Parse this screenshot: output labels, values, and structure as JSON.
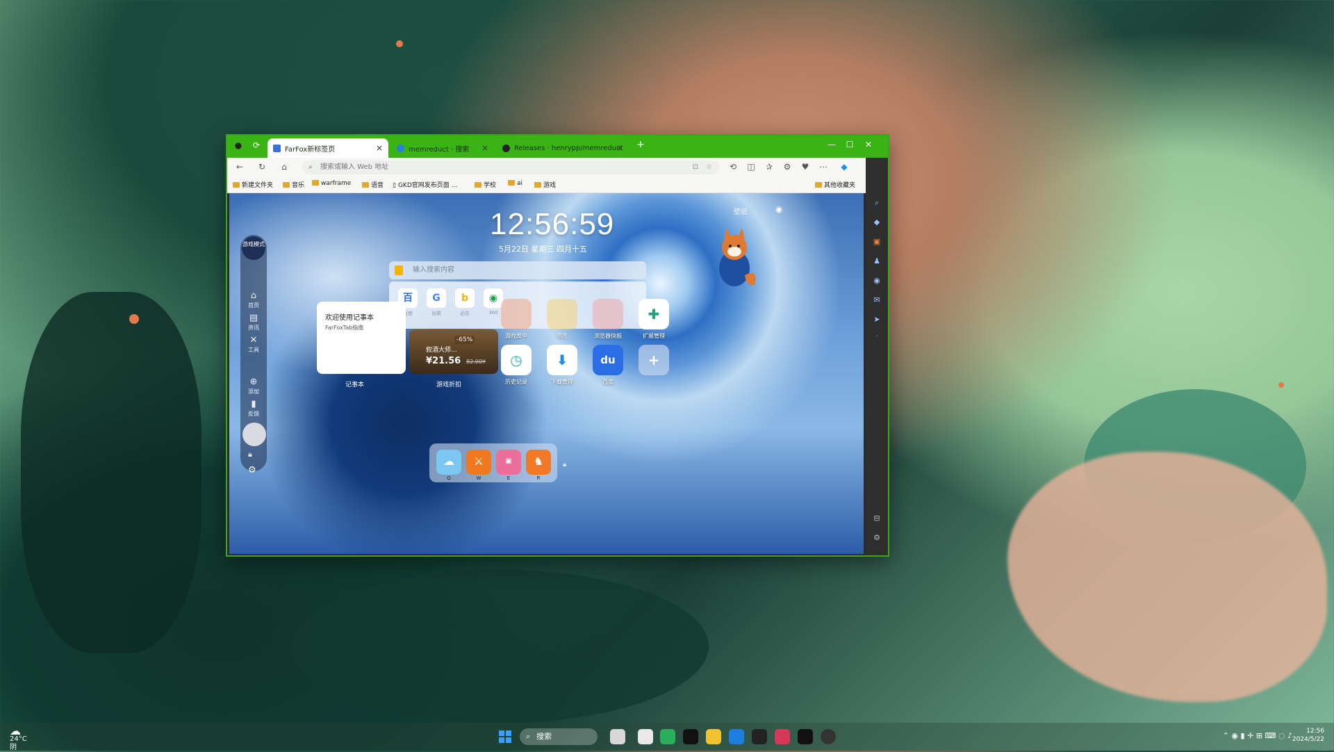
{
  "browser": {
    "tabs": [
      {
        "label": "FarFox新标签页",
        "close": "×"
      },
      {
        "label": "memreduct · 搜索",
        "close": "×"
      },
      {
        "label": "Releases · henrypp/memreduct",
        "close": "×"
      }
    ],
    "new_tab": "+",
    "window_controls": {
      "minimize": "—",
      "maximize": "☐",
      "close": "✕"
    },
    "address_placeholder": "搜索或输入 Web 地址",
    "bookmarks": [
      "新建文件夹",
      "音乐",
      "warframe",
      "语音",
      "GKD官网发布页面 ...",
      "学校",
      "ai",
      "游戏"
    ],
    "other_bookmarks": "其他收藏夹"
  },
  "newtab": {
    "clock": "12:56:59",
    "date": "5月22日  星期三  四月十五",
    "top_right_label": "壁纸",
    "sidebar": {
      "game_mode": "游戏模式",
      "items": [
        "首页",
        "资讯",
        "工具",
        "添加",
        "反馈"
      ]
    },
    "search_placeholder": "输入搜索内容",
    "engines": [
      {
        "label": "百度",
        "glyph": "百",
        "color": "#2b6de5"
      },
      {
        "label": "谷歌",
        "glyph": "G",
        "color": "#4285f4"
      },
      {
        "label": "必应",
        "glyph": "b",
        "color": "#f5b400"
      },
      {
        "label": "360",
        "glyph": "◉",
        "color": "#1aa34a"
      }
    ],
    "note_widget": {
      "title": "欢迎使用记事本",
      "subtitle": "FarFoxTab指南",
      "label": "记事本"
    },
    "deal_widget": {
      "name": "叙酒大师...",
      "price": "¥21.56",
      "original": "82.00¥",
      "discount": "-65%",
      "label": "游戏折扣"
    },
    "apps": [
      {
        "label": "游戏库中",
        "glyph": "●",
        "color": "#f4a07a"
      },
      {
        "label": "书签",
        "glyph": "●",
        "color": "#f5d06b"
      },
      {
        "label": "浏览器快报",
        "glyph": "●",
        "color": "#f2a3a3"
      },
      {
        "label": "扩展管理",
        "glyph": "✚",
        "color": "#1fa37f"
      },
      {
        "label": "历史记录",
        "glyph": "◷",
        "color": "#22b5b0"
      },
      {
        "label": "下载管理",
        "glyph": "⬇",
        "color": "#1d8fe6"
      },
      {
        "label": "百度",
        "glyph": "du",
        "color": "#2b6de5"
      },
      {
        "label": "",
        "glyph": "+",
        "color": "#c5d6ee"
      }
    ],
    "dock": [
      {
        "key": "Q",
        "color": "#7cc6f2",
        "glyph": "☁"
      },
      {
        "key": "W",
        "color": "#f0781e",
        "glyph": "剑"
      },
      {
        "key": "E",
        "color": "#ec6f9a",
        "glyph": "bili"
      },
      {
        "key": "R",
        "color": "#f07a28",
        "glyph": "♞"
      }
    ]
  },
  "taskbar": {
    "weather_temp": "24°C",
    "weather_desc": "阴",
    "search_label": "搜索",
    "time": "12:56",
    "date": "2024/5/22"
  }
}
